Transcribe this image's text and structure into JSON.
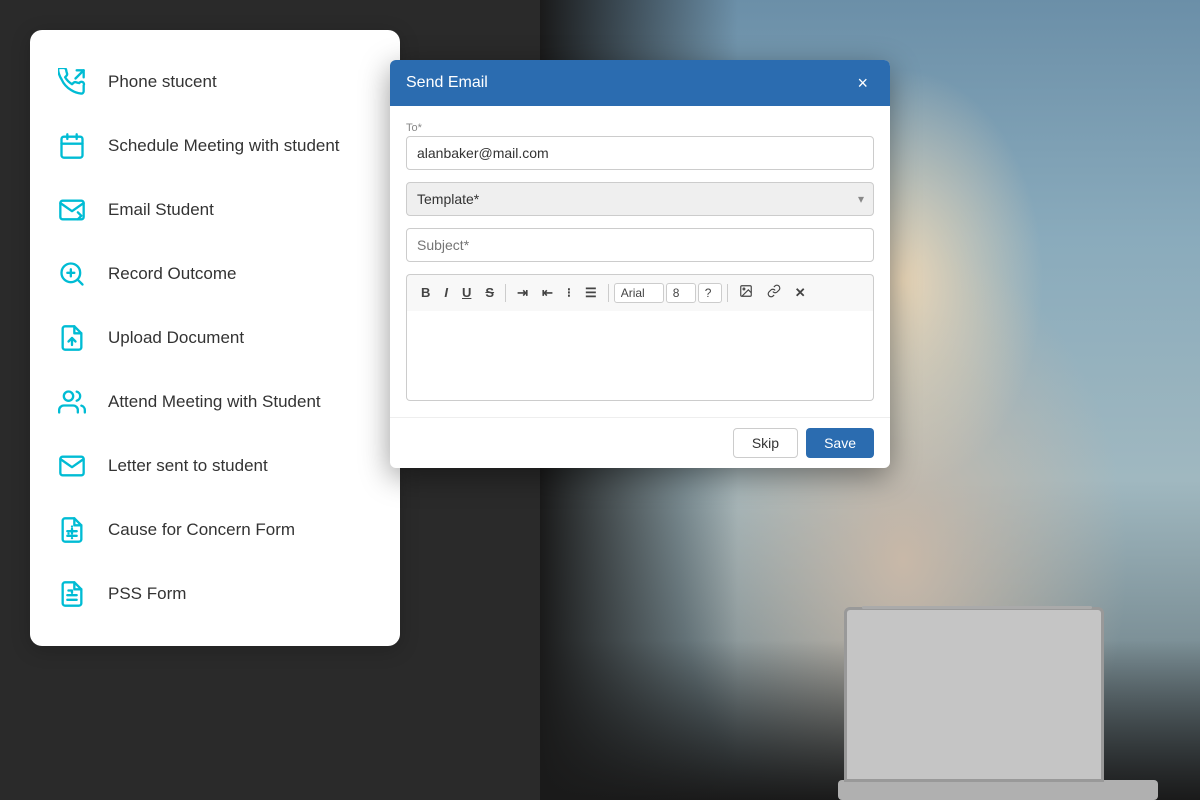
{
  "modal": {
    "title": "Send Email",
    "close_label": "×",
    "to_label": "To*",
    "to_value": "alanbaker@mail.com",
    "template_label": "Template*",
    "template_placeholder": "Template*",
    "subject_label": "Subject*",
    "subject_placeholder": "Subject*",
    "skip_label": "Skip",
    "save_label": "Save",
    "toolbar": {
      "bold": "B",
      "italic": "I",
      "underline": "U",
      "strikethrough": "S",
      "font_name": "Arial",
      "font_size": "8",
      "extra": "?"
    }
  },
  "menu": {
    "items": [
      {
        "id": "phone-student",
        "label": "Phone stucent"
      },
      {
        "id": "schedule-meeting",
        "label": "Schedule Meeting with student"
      },
      {
        "id": "email-student",
        "label": "Email Student"
      },
      {
        "id": "record-outcome",
        "label": "Record Outcome"
      },
      {
        "id": "upload-document",
        "label": "Upload Document"
      },
      {
        "id": "attend-meeting",
        "label": "Attend Meeting with Student"
      },
      {
        "id": "letter-sent",
        "label": "Letter sent to student"
      },
      {
        "id": "cause-concern",
        "label": "Cause for Concern Form"
      },
      {
        "id": "pss-form",
        "label": "PSS Form"
      }
    ]
  },
  "colors": {
    "accent": "#00bcd4",
    "header_bg": "#2b6cb0",
    "modal_bg": "#ffffff",
    "menu_bg": "#ffffff"
  }
}
